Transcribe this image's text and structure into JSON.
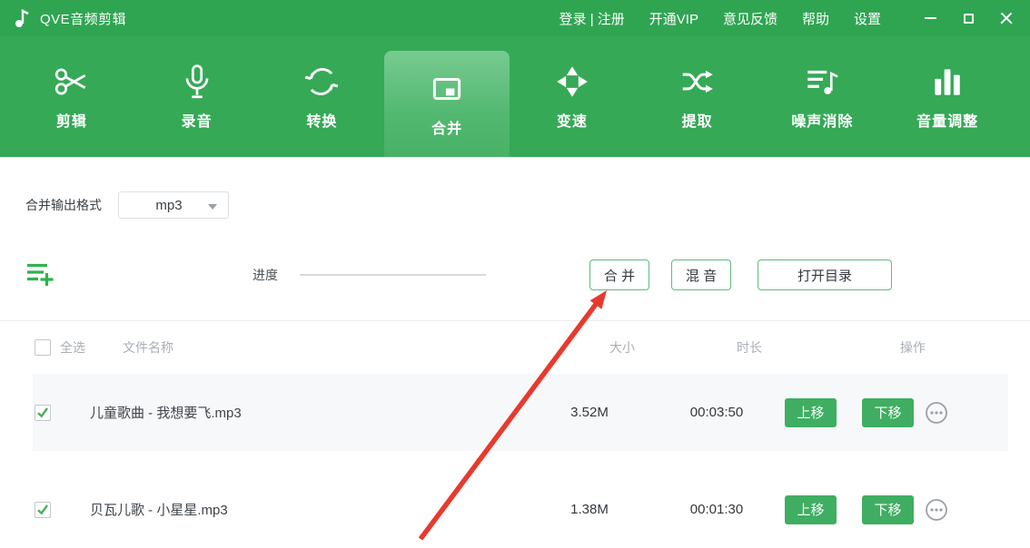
{
  "window": {
    "title": "QVE音频剪辑"
  },
  "titlebar": {
    "menu": [
      {
        "label": "登录 | 注册"
      },
      {
        "label": "开通VIP"
      },
      {
        "label": "意见反馈"
      },
      {
        "label": "帮助"
      },
      {
        "label": "设置"
      }
    ]
  },
  "toolbar": {
    "tabs": [
      {
        "label": "剪辑",
        "icon": "scissors-icon",
        "active": false
      },
      {
        "label": "录音",
        "icon": "microphone-icon",
        "active": false
      },
      {
        "label": "转换",
        "icon": "convert-icon",
        "active": false
      },
      {
        "label": "合并",
        "icon": "merge-icon",
        "active": true
      },
      {
        "label": "变速",
        "icon": "speed-icon",
        "active": false
      },
      {
        "label": "提取",
        "icon": "extract-icon",
        "active": false
      },
      {
        "label": "噪声消除",
        "icon": "noise-removal-icon",
        "active": false
      },
      {
        "label": "音量调整",
        "icon": "volume-bars-icon",
        "active": false
      }
    ]
  },
  "merge_panel": {
    "output_format_label": "合并输出格式",
    "output_format_value": "mp3",
    "progress_label": "进度",
    "buttons": {
      "merge": "合 并",
      "mix": "混 音",
      "open_dir": "打开目录"
    }
  },
  "file_table": {
    "select_all": "全选",
    "headers": {
      "name": "文件名称",
      "size": "大小",
      "duration": "时长",
      "actions": "操作"
    },
    "rows": [
      {
        "checked": true,
        "name": "儿童歌曲 - 我想要飞.mp3",
        "size": "3.52M",
        "duration": "00:03:50",
        "move_up": "上移",
        "move_down": "下移"
      },
      {
        "checked": true,
        "name": "贝瓦儿歌 - 小星星.mp3",
        "size": "1.38M",
        "duration": "00:01:30",
        "move_up": "上移",
        "move_down": "下移"
      }
    ]
  },
  "colors": {
    "titlebar_green": "#2fa552",
    "toolbar_green": "#35a956",
    "active_tab_green": "#5cbb81",
    "button_green": "#3fae62",
    "arrow_red": "#e83a2c",
    "row_stripe": "#f7f8fa",
    "muted_text": "#a9afb6"
  }
}
